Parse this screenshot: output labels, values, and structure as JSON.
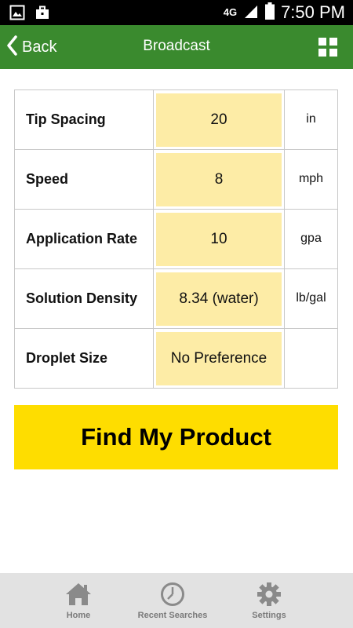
{
  "status_bar": {
    "network": "4G",
    "time": "7:50 PM",
    "icons": [
      "picture-icon",
      "briefcase-icon",
      "signal-icon",
      "battery-icon"
    ]
  },
  "header": {
    "back_label": "Back",
    "title": "Broadcast",
    "menu_icon": "grid-icon",
    "color": "#3a8a2e"
  },
  "form": {
    "rows": [
      {
        "label": "Tip Spacing",
        "value": "20",
        "unit": "in"
      },
      {
        "label": "Speed",
        "value": "8",
        "unit": "mph"
      },
      {
        "label": "Application Rate",
        "value": "10",
        "unit": "gpa"
      },
      {
        "label": "Solution Density",
        "value": "8.34 (water)",
        "unit": "lb/gal"
      },
      {
        "label": "Droplet Size",
        "value": "No Preference",
        "unit": ""
      }
    ],
    "input_color": "#fdeca6"
  },
  "action": {
    "find_label": "Find My Product",
    "color": "#fedd00"
  },
  "bottom_nav": {
    "items": [
      {
        "label": "Home",
        "icon": "home-icon"
      },
      {
        "label": "Recent Searches",
        "icon": "clock-icon"
      },
      {
        "label": "Settings",
        "icon": "gear-icon"
      }
    ]
  }
}
